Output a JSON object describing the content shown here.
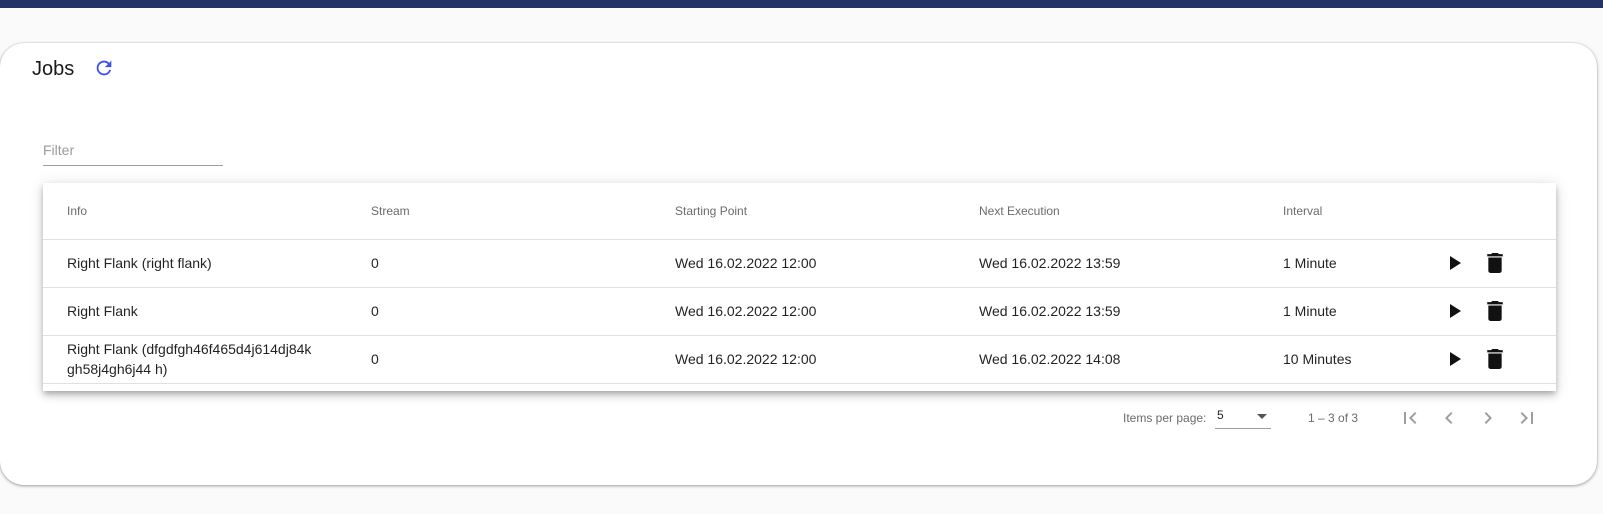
{
  "header": {
    "bar_color": "#223366"
  },
  "card": {
    "title": "Jobs",
    "refresh_icon": "refresh-icon",
    "accent": "#3f51e8"
  },
  "filter": {
    "placeholder": "Filter",
    "value": ""
  },
  "table": {
    "columns": {
      "info": "Info",
      "stream": "Stream",
      "starting_point": "Starting Point",
      "next_execution": "Next Execution",
      "interval": "Interval"
    },
    "rows": [
      {
        "info": "Right Flank (right flank)",
        "stream": "0",
        "starting_point": "Wed 16.02.2022 12:00",
        "next_execution": "Wed 16.02.2022 13:59",
        "interval": "1 Minute"
      },
      {
        "info": "Right Flank",
        "stream": "0",
        "starting_point": "Wed 16.02.2022 12:00",
        "next_execution": "Wed 16.02.2022 13:59",
        "interval": "1 Minute"
      },
      {
        "info": "Right Flank (dfgdfgh46f465d4j614dj84k gh58j4gh6j44 h)",
        "stream": "0",
        "starting_point": "Wed 16.02.2022 12:00",
        "next_execution": "Wed 16.02.2022 14:08",
        "interval": "10 Minutes"
      }
    ],
    "row_actions": [
      "play-icon",
      "delete-icon"
    ]
  },
  "paginator": {
    "items_per_page_label": "Items per page:",
    "page_size": "5",
    "range_label": "1 – 3 of 3",
    "icons": [
      "first-page-icon",
      "previous-page-icon",
      "next-page-icon",
      "last-page-icon"
    ]
  }
}
